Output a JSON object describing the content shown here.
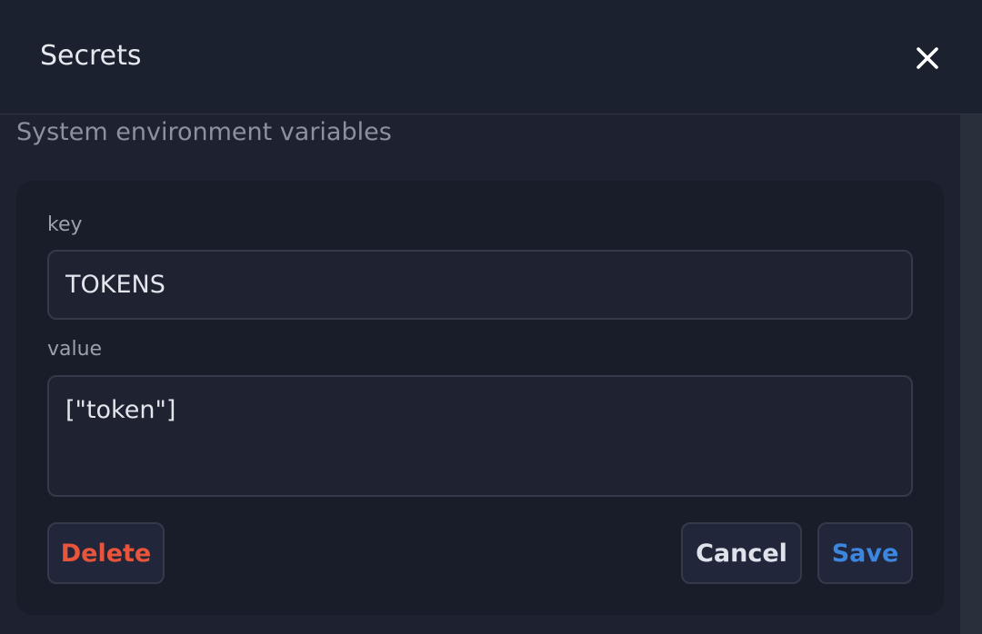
{
  "header": {
    "title": "Secrets"
  },
  "section": {
    "subtitle": "System environment variables"
  },
  "form": {
    "key_label": "key",
    "key_value": "TOKENS",
    "value_label": "value",
    "value_value": "[\"token\"]"
  },
  "buttons": {
    "delete": "Delete",
    "cancel": "Cancel",
    "save": "Save"
  },
  "icons": {
    "close": "close-icon"
  },
  "colors": {
    "background": "#1e2230",
    "card": "#191d29",
    "delete": "#e8553a",
    "save": "#3d86e0"
  }
}
